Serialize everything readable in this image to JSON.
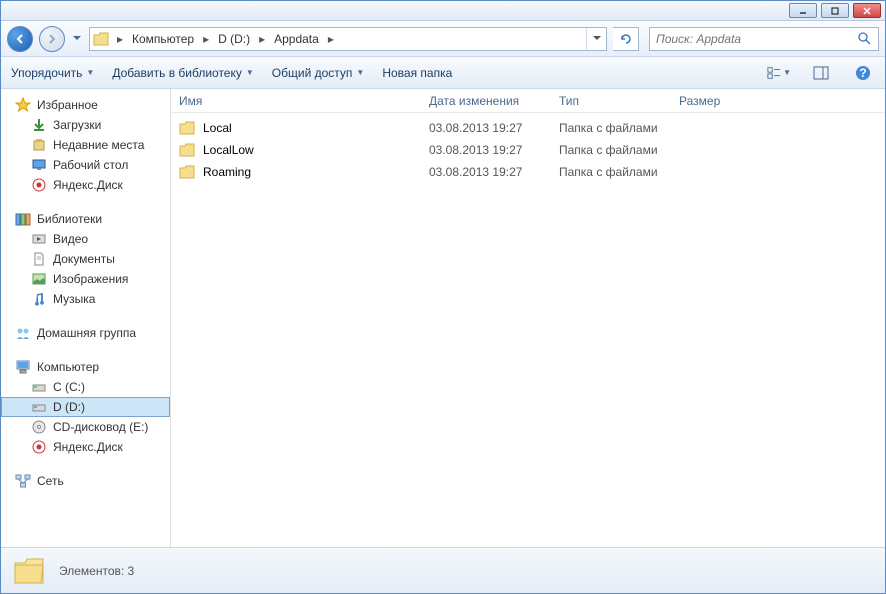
{
  "breadcrumb": {
    "seg1": "Компьютер",
    "seg2": "D (D:)",
    "seg3": "Appdata"
  },
  "search": {
    "placeholder": "Поиск: Appdata"
  },
  "toolbar": {
    "organize": "Упорядочить",
    "addlib": "Добавить в библиотеку",
    "share": "Общий доступ",
    "newfolder": "Новая папка"
  },
  "sidebar": {
    "fav": {
      "label": "Избранное",
      "items": [
        "Загрузки",
        "Недавние места",
        "Рабочий стол",
        "Яндекс.Диск"
      ]
    },
    "lib": {
      "label": "Библиотеки",
      "items": [
        "Видео",
        "Документы",
        "Изображения",
        "Музыка"
      ]
    },
    "home": {
      "label": "Домашняя группа"
    },
    "comp": {
      "label": "Компьютер",
      "items": [
        "С (C:)",
        "D (D:)",
        "CD-дисковод (E:)",
        "Яндекс.Диск"
      ]
    },
    "net": {
      "label": "Сеть"
    }
  },
  "columns": {
    "name": "Имя",
    "date": "Дата изменения",
    "type": "Тип",
    "size": "Размер"
  },
  "files": [
    {
      "name": "Local",
      "date": "03.08.2013 19:27",
      "type": "Папка с файлами"
    },
    {
      "name": "LocalLow",
      "date": "03.08.2013 19:27",
      "type": "Папка с файлами"
    },
    {
      "name": "Roaming",
      "date": "03.08.2013 19:27",
      "type": "Папка с файлами"
    }
  ],
  "status": {
    "text": "Элементов: 3"
  }
}
